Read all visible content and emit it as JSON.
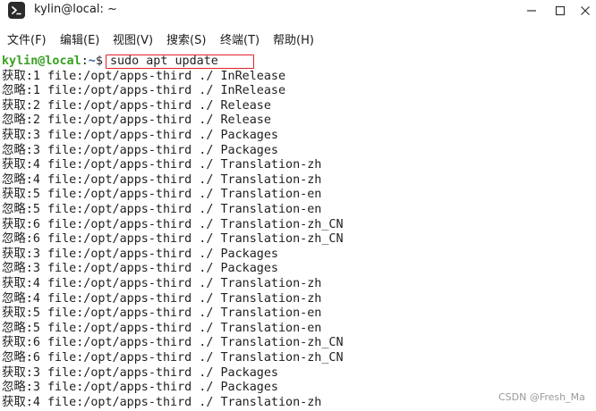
{
  "window": {
    "title": "kylin@local: ~",
    "icon": "terminal-icon",
    "controls": [
      "minimize-icon",
      "maximize-icon",
      "close-icon"
    ]
  },
  "menubar": {
    "items": [
      {
        "label": "文件(F)"
      },
      {
        "label": "编辑(E)"
      },
      {
        "label": "视图(V)"
      },
      {
        "label": "搜索(S)"
      },
      {
        "label": "终端(T)"
      },
      {
        "label": "帮助(H)"
      }
    ]
  },
  "terminal": {
    "prompt": {
      "user_host": "kylin@local",
      "separator": ":",
      "path": "~",
      "symbol": "$ ",
      "command": "sudo apt update"
    },
    "lines": [
      "获取:1 file:/opt/apps-third ./ InRelease",
      "忽略:1 file:/opt/apps-third ./ InRelease",
      "获取:2 file:/opt/apps-third ./ Release",
      "忽略:2 file:/opt/apps-third ./ Release",
      "获取:3 file:/opt/apps-third ./ Packages",
      "忽略:3 file:/opt/apps-third ./ Packages",
      "获取:4 file:/opt/apps-third ./ Translation-zh",
      "忽略:4 file:/opt/apps-third ./ Translation-zh",
      "获取:5 file:/opt/apps-third ./ Translation-en",
      "忽略:5 file:/opt/apps-third ./ Translation-en",
      "获取:6 file:/opt/apps-third ./ Translation-zh_CN",
      "忽略:6 file:/opt/apps-third ./ Translation-zh_CN",
      "获取:3 file:/opt/apps-third ./ Packages",
      "忽略:3 file:/opt/apps-third ./ Packages",
      "获取:4 file:/opt/apps-third ./ Translation-zh",
      "忽略:4 file:/opt/apps-third ./ Translation-zh",
      "获取:5 file:/opt/apps-third ./ Translation-en",
      "忽略:5 file:/opt/apps-third ./ Translation-en",
      "获取:6 file:/opt/apps-third ./ Translation-zh_CN",
      "忽略:6 file:/opt/apps-third ./ Translation-zh_CN",
      "获取:3 file:/opt/apps-third ./ Packages",
      "忽略:3 file:/opt/apps-third ./ Packages",
      "获取:4 file:/opt/apps-third ./ Translation-zh"
    ],
    "highlight_color": "#e0202a"
  },
  "watermark": "CSDN @Fresh_Ma",
  "colors": {
    "prompt_user": "#3aa023",
    "prompt_path": "#3465a4",
    "text": "#1e1e1e",
    "background": "#ffffff"
  }
}
